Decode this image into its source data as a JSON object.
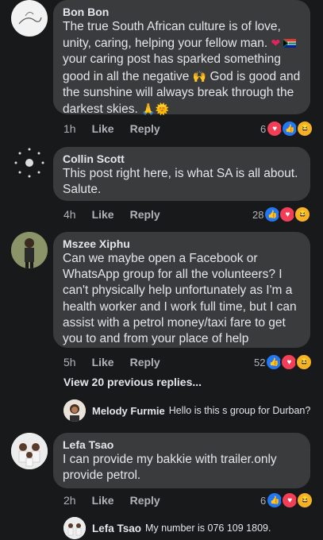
{
  "comments": [
    {
      "author": "Bon Bon",
      "lines": [
        "The true South African culture is of love,",
        "unity, caring, helping your fellow man.",
        "your caring post has sparked something",
        "good in all the negative",
        "God is good and",
        "the sunshine will always break through the",
        "darkest skies."
      ],
      "time": "1h",
      "like_label": "Like",
      "reply_label": "Reply",
      "reaction_count": "6"
    },
    {
      "author": "Collin Scott",
      "lines": [
        "This post right here, is what SA is all about.",
        "Salute."
      ],
      "time": "4h",
      "like_label": "Like",
      "reply_label": "Reply",
      "reaction_count": "28"
    },
    {
      "author": "Mszee Xiphu",
      "lines": [
        "Can we maybe open a Facebook or",
        "WhatsApp group for all the volunteers? I",
        "can't physically help unfortunately as I'm a",
        "health worker and I work full time, but I can",
        "assist with a petrol  money/taxi fare to get",
        "you to and from your place of help"
      ],
      "time": "5h",
      "like_label": "Like",
      "reply_label": "Reply",
      "reaction_count": "52",
      "view_previous": "View 20 previous replies...",
      "reply": {
        "author": "Melody Furmie",
        "text": "Hello is this s group for Durban?"
      }
    },
    {
      "author": "Lefa Tsao",
      "lines": [
        "I can provide my bakkie with trailer.only",
        "provide petrol."
      ],
      "time": "2h",
      "like_label": "Like",
      "reply_label": "Reply",
      "reaction_count": "6",
      "reply": {
        "author": "Lefa Tsao",
        "text": "My number is 076 109 1809."
      }
    }
  ]
}
